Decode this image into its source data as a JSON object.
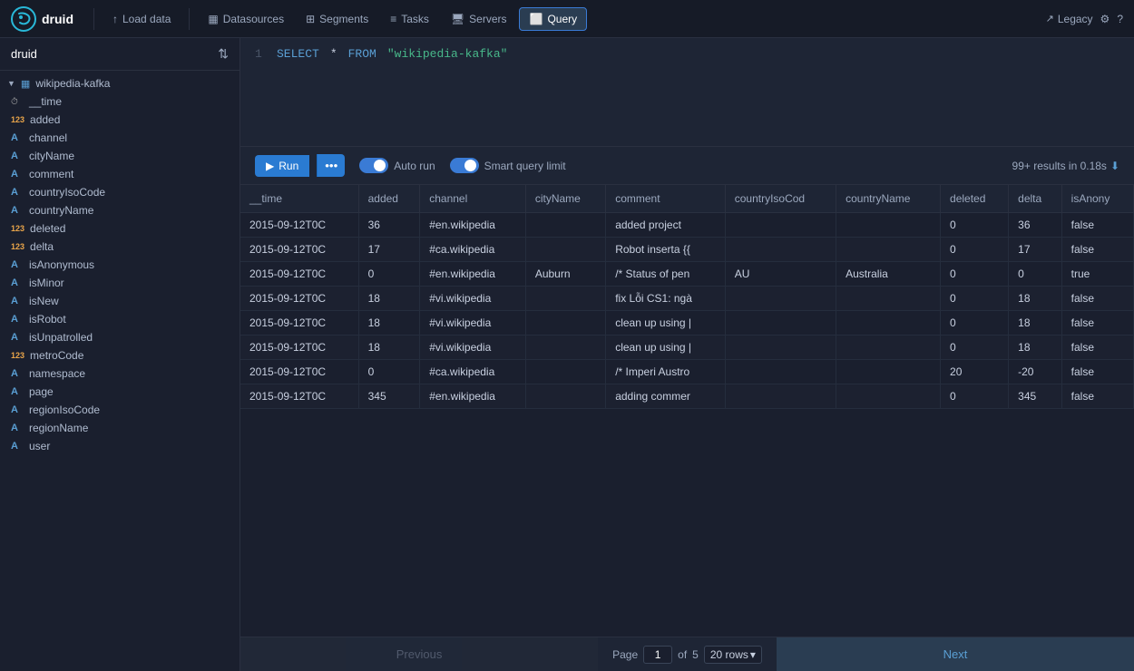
{
  "app": {
    "name": "druid",
    "logo_text": "druid"
  },
  "nav": {
    "items": [
      {
        "label": "Load data",
        "icon": "upload-icon",
        "active": false
      },
      {
        "label": "Datasources",
        "icon": "datasources-icon",
        "active": false
      },
      {
        "label": "Segments",
        "icon": "segments-icon",
        "active": false
      },
      {
        "label": "Tasks",
        "icon": "tasks-icon",
        "active": false
      },
      {
        "label": "Servers",
        "icon": "servers-icon",
        "active": false
      },
      {
        "label": "Query",
        "icon": "query-icon",
        "active": true
      }
    ],
    "right": {
      "legacy": "Legacy",
      "settings_icon": "gear-icon",
      "help_icon": "help-icon"
    }
  },
  "sidebar": {
    "title": "druid",
    "datasource": "wikipedia-kafka",
    "columns": [
      {
        "name": "__time",
        "type": "time"
      },
      {
        "name": "added",
        "type": "number"
      },
      {
        "name": "channel",
        "type": "string"
      },
      {
        "name": "cityName",
        "type": "string"
      },
      {
        "name": "comment",
        "type": "string"
      },
      {
        "name": "countryIsoCode",
        "type": "string"
      },
      {
        "name": "countryName",
        "type": "string"
      },
      {
        "name": "deleted",
        "type": "number"
      },
      {
        "name": "delta",
        "type": "number"
      },
      {
        "name": "isAnonymous",
        "type": "string"
      },
      {
        "name": "isMinor",
        "type": "string"
      },
      {
        "name": "isNew",
        "type": "string"
      },
      {
        "name": "isRobot",
        "type": "string"
      },
      {
        "name": "isUnpatrolled",
        "type": "string"
      },
      {
        "name": "metroCode",
        "type": "number"
      },
      {
        "name": "namespace",
        "type": "string"
      },
      {
        "name": "page",
        "type": "string"
      },
      {
        "name": "regionIsoCode",
        "type": "string"
      },
      {
        "name": "regionName",
        "type": "string"
      },
      {
        "name": "user",
        "type": "string"
      }
    ]
  },
  "query": {
    "line_number": "1",
    "keyword_select": "SELECT",
    "star": "*",
    "keyword_from": "FROM",
    "table": "\"wikipedia-kafka\""
  },
  "toolbar": {
    "run_label": "Run",
    "more_dots": "···",
    "autorun_label": "Auto run",
    "smart_query_label": "Smart query limit",
    "results_info": "99+ results in 0.18s",
    "download_icon": "download-icon"
  },
  "table": {
    "columns": [
      "__time",
      "added",
      "channel",
      "cityName",
      "comment",
      "countryIsoCod",
      "countryName",
      "deleted",
      "delta",
      "isAnony"
    ],
    "rows": [
      {
        "__time": "2015-09-12T0C",
        "added": "36",
        "channel": "#en.wikipedia",
        "cityName": "",
        "comment": "added project",
        "countryIsoCod": "",
        "countryName": "",
        "deleted": "0",
        "delta": "36",
        "isAnony": "false"
      },
      {
        "__time": "2015-09-12T0C",
        "added": "17",
        "channel": "#ca.wikipedia",
        "cityName": "",
        "comment": "Robot inserta {{",
        "countryIsoCod": "",
        "countryName": "",
        "deleted": "0",
        "delta": "17",
        "isAnony": "false"
      },
      {
        "__time": "2015-09-12T0C",
        "added": "0",
        "channel": "#en.wikipedia",
        "cityName": "Auburn",
        "comment": "/* Status of pen",
        "countryIsoCod": "AU",
        "countryName": "Australia",
        "deleted": "0",
        "delta": "0",
        "isAnony": "true"
      },
      {
        "__time": "2015-09-12T0C",
        "added": "18",
        "channel": "#vi.wikipedia",
        "cityName": "",
        "comment": "fix Lỗi CS1: ngà",
        "countryIsoCod": "",
        "countryName": "",
        "deleted": "0",
        "delta": "18",
        "isAnony": "false"
      },
      {
        "__time": "2015-09-12T0C",
        "added": "18",
        "channel": "#vi.wikipedia",
        "cityName": "",
        "comment": "clean up using |",
        "countryIsoCod": "",
        "countryName": "",
        "deleted": "0",
        "delta": "18",
        "isAnony": "false"
      },
      {
        "__time": "2015-09-12T0C",
        "added": "18",
        "channel": "#vi.wikipedia",
        "cityName": "",
        "comment": "clean up using |",
        "countryIsoCod": "",
        "countryName": "",
        "deleted": "0",
        "delta": "18",
        "isAnony": "false"
      },
      {
        "__time": "2015-09-12T0C",
        "added": "0",
        "channel": "#ca.wikipedia",
        "cityName": "",
        "comment": "/* Imperi Austro",
        "countryIsoCod": "",
        "countryName": "",
        "deleted": "20",
        "delta": "-20",
        "isAnony": "false"
      },
      {
        "__time": "2015-09-12T0C",
        "added": "345",
        "channel": "#en.wikipedia",
        "cityName": "",
        "comment": "adding commer",
        "countryIsoCod": "",
        "countryName": "",
        "deleted": "0",
        "delta": "345",
        "isAnony": "false"
      }
    ]
  },
  "pagination": {
    "previous_label": "Previous",
    "next_label": "Next",
    "page_label": "Page",
    "current_page": "1",
    "of_label": "of",
    "total_pages": "5",
    "rows_label": "20 rows"
  }
}
